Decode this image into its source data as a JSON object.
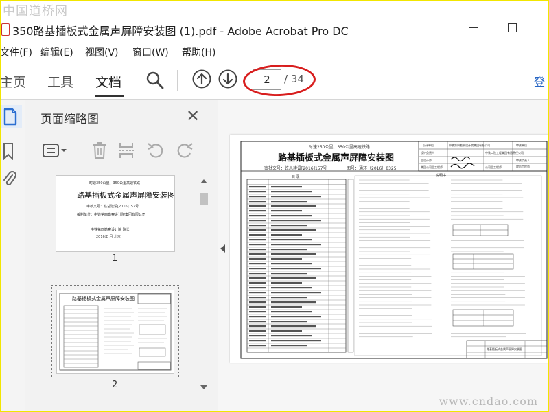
{
  "watermark": {
    "top": "中国道桥网",
    "bottom": "www.cndao.com"
  },
  "window": {
    "title": "350路基插板式金属声屏障安装图 (1).pdf - Adobe Acrobat Pro DC"
  },
  "menu": {
    "items": [
      "文件(F)",
      "编辑(E)",
      "视图(V)",
      "窗口(W)",
      "帮助(H)"
    ]
  },
  "toolbar": {
    "tabs": [
      "主页",
      "工具",
      "文档"
    ],
    "active_tab": "文档",
    "current_page": "2",
    "total_pages": "/ 34",
    "right_edge_char": "登",
    "icons": [
      "search-icon",
      "prev-page-icon",
      "next-page-icon"
    ]
  },
  "sidebar": {
    "icons": [
      "page-thumbnails-icon",
      "bookmarks-icon",
      "attachments-icon"
    ]
  },
  "thumbnail_panel": {
    "title": "页面缩略图",
    "tool_icons": [
      "options-menu-icon",
      "delete-page-icon",
      "extract-page-icon",
      "rotate-left-icon",
      "rotate-right-icon"
    ],
    "thumbnails": [
      {
        "number": "1",
        "line1": "时速350公里、350公里高速铁路",
        "line2": "路基插板式金属声屏障安装图",
        "line3": "审核文号：铁总建设[2016]157号",
        "line4": "编制单位：中铁第四勘察设计院集团有限公司",
        "line5": "中铁第四勘察设计院   院长",
        "line6": "2016年 月 北京"
      },
      {
        "number": "2",
        "line1": "路基插板式金属声屏障安装图"
      }
    ]
  },
  "document_page": {
    "header_line1": "时速250公里、350公里高速铁路",
    "title": "路基插板式金属声屏障安装图",
    "approval": "审批文号：铁总建设[2016]157号",
    "drawing_no": "图号：通环（2016）8325",
    "toc_heading": "目    录",
    "notes_heading": "说明书",
    "title_block": {
      "design_unit": "设计单位",
      "design_unit_name": "中铁第四勘察设计院集团有限公司",
      "approval_unit": "审核单位",
      "approval_unit_name": "中铁二院工程集团有限责任公司",
      "roles": [
        "设计负责人",
        "总设计师",
        "集团公司总工程师"
      ],
      "roles_right": [
        "审核负责人",
        "院总工程师",
        "公司总工程师"
      ],
      "footer_title": "路基插板式金属声屏障安装图"
    }
  }
}
